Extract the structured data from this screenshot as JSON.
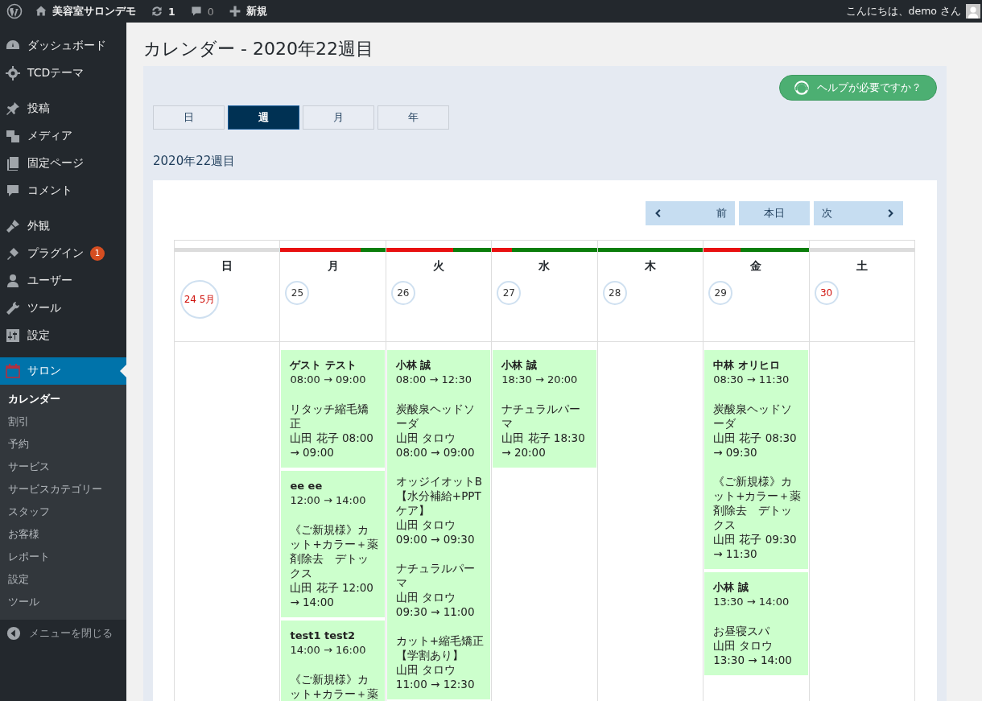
{
  "admin_bar": {
    "site_name": "美容室サロンデモ",
    "updates": "1",
    "comments": "0",
    "new_label": "新規",
    "greeting": "こんにちは、demo さん"
  },
  "sidebar": {
    "groups": [
      [
        {
          "label": "ダッシュボード",
          "selected": false
        },
        {
          "label": "TCDテーマ",
          "selected": false
        }
      ],
      [
        {
          "label": "投稿",
          "selected": false
        },
        {
          "label": "メディア",
          "selected": false
        },
        {
          "label": "固定ページ",
          "selected": false
        },
        {
          "label": "コメント",
          "selected": false
        }
      ],
      [
        {
          "label": "外観",
          "selected": false
        },
        {
          "label": "プラグイン",
          "selected": false,
          "badge": "1"
        },
        {
          "label": "ユーザー",
          "selected": false
        },
        {
          "label": "ツール",
          "selected": false
        },
        {
          "label": "設定",
          "selected": false
        }
      ],
      [
        {
          "label": "サロン",
          "selected": true
        }
      ]
    ],
    "submenu": [
      {
        "label": "カレンダー",
        "selected": true
      },
      {
        "label": "割引",
        "selected": false
      },
      {
        "label": "予約",
        "selected": false
      },
      {
        "label": "サービス",
        "selected": false
      },
      {
        "label": "サービスカテゴリー",
        "selected": false
      },
      {
        "label": "スタッフ",
        "selected": false
      },
      {
        "label": "お客様",
        "selected": false
      },
      {
        "label": "レポート",
        "selected": false
      },
      {
        "label": "設定",
        "selected": false
      },
      {
        "label": "ツール",
        "selected": false
      }
    ],
    "collapse_label": "メニューを閉じる"
  },
  "page_title": "カレンダー - 2020年22週目",
  "help_button": "ヘルプが必要ですか？",
  "view_tabs": [
    {
      "label": "日",
      "selected": false
    },
    {
      "label": "週",
      "selected": true
    },
    {
      "label": "月",
      "selected": false
    },
    {
      "label": "年",
      "selected": false
    }
  ],
  "week_heading": "2020年22週目",
  "nav": {
    "prev": "前",
    "today": "本日",
    "next": "次"
  },
  "days": [
    {
      "weekday": "日",
      "date": "24 5月",
      "weekend": true,
      "today": true,
      "closed": true
    },
    {
      "weekday": "月",
      "date": "25",
      "weekend": false,
      "today": false,
      "closed": false,
      "level": 0.76,
      "appointments": [
        {
          "customer": "ゲスト テスト",
          "time": "08:00 → 09:00",
          "services": [
            {
              "name": "リタッチ縮毛矯正",
              "staff_time": "山田 花子 08:00 → 09:00"
            }
          ]
        },
        {
          "customer": "ee ee",
          "time": "12:00 → 14:00",
          "services": [
            {
              "name": "《ご新規様》カット+カラー＋薬剤除去　デトックス",
              "staff_time": "山田 花子 12:00 → 14:00"
            }
          ]
        },
        {
          "customer": "test1 test2",
          "time": "14:00 → 16:00",
          "services": [
            {
              "name": "《ご新規様》カット+カラー＋薬"
            }
          ]
        }
      ]
    },
    {
      "weekday": "火",
      "date": "26",
      "weekend": false,
      "today": false,
      "closed": false,
      "level": 0.64,
      "appointments": [
        {
          "customer": "小林 誠",
          "time": "08:00 → 12:30",
          "services": [
            {
              "name": "炭酸泉ヘッドソーダ",
              "staff_time": "山田 タロウ 08:00 → 09:00"
            },
            {
              "name": "オッジイオットB【水分補給+PPTケア】",
              "staff_time": "山田 タロウ 09:00 → 09:30"
            },
            {
              "name": "ナチュラルパーマ",
              "staff_time": "山田 タロウ 09:30 → 11:00"
            },
            {
              "name": "カット+縮毛矯正【学割あり】",
              "staff_time": "山田 タロウ 11:00 → 12:30"
            }
          ]
        }
      ]
    },
    {
      "weekday": "水",
      "date": "27",
      "weekend": false,
      "today": false,
      "closed": false,
      "level": 0.19,
      "appointments": [
        {
          "customer": "小林 誠",
          "time": "18:30 → 20:00",
          "services": [
            {
              "name": "ナチュラルパーマ",
              "staff_time": "山田 花子 18:30 → 20:00"
            }
          ]
        }
      ]
    },
    {
      "weekday": "木",
      "date": "28",
      "weekend": false,
      "today": false,
      "closed": false,
      "level": 0
    },
    {
      "weekday": "金",
      "date": "29",
      "weekend": false,
      "today": false,
      "closed": false,
      "level": 0.35,
      "appointments": [
        {
          "customer": "中林 オリヒロ",
          "time": "08:30 → 11:30",
          "services": [
            {
              "name": "炭酸泉ヘッドソーダ",
              "staff_time": "山田 花子 08:30 → 09:30"
            },
            {
              "name": "《ご新規様》カット+カラー＋薬剤除去　デトックス",
              "staff_time": "山田 花子 09:30 → 11:30"
            }
          ]
        },
        {
          "customer": "小林 誠",
          "time": "13:30 → 14:00",
          "services": [
            {
              "name": "お昼寝スパ",
              "staff_time": "山田 タロウ 13:30 → 14:00"
            }
          ]
        }
      ]
    },
    {
      "weekday": "土",
      "date": "30",
      "weekend": true,
      "today": false,
      "closed": true
    }
  ]
}
